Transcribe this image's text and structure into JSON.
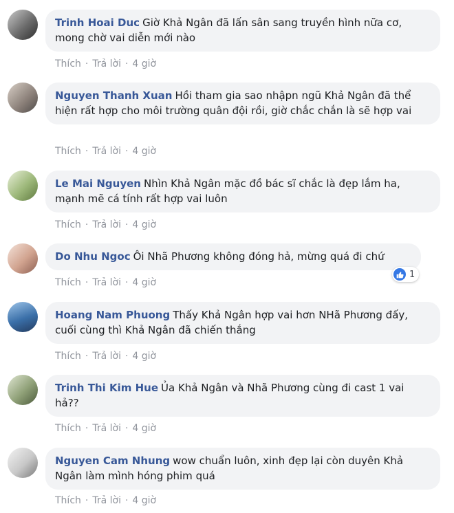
{
  "actions": {
    "like": "Thích",
    "reply": "Trả lời",
    "time": "4 giờ"
  },
  "comments": [
    {
      "author": "Trinh Hoai Duc",
      "text": "Giờ Khả Ngân đã lấn sân sang truyền hình nữa cơ, mong chờ vai diễn mới nào"
    },
    {
      "author": "Nguyen Thanh Xuan",
      "text": "Hồi tham gia sao nhậpn ngũ Khả Ngân đã thể hiện rất hợp cho môi trường quân đội rồi, giờ chắc chắn là sẽ hợp vai"
    },
    {
      "author": "Le Mai Nguyen",
      "text": "Nhìn Khả Ngân mặc đồ bác sĩ chắc là đẹp lắm ha, mạnh mẽ cá tính rất hợp vai luôn"
    },
    {
      "author": "Do Nhu Ngoc",
      "text": "Ôi Nhã Phương không đóng hả, mừng quá đi chứ",
      "reaction_count": "1"
    },
    {
      "author": "Hoang Nam Phuong",
      "text": "Thấy Khả Ngân hợp vai hơn NHã Phương đấy, cuối cùng thì Khả Ngân đã chiến thắng"
    },
    {
      "author": "Trinh Thi Kim Hue",
      "text": "Ủa Khả Ngân và Nhã Phương cùng đi cast 1 vai hả??"
    },
    {
      "author": "Nguyen Cam Nhung",
      "text": "wow chuẩn luôn, xinh đẹp lại còn duyên Khả Ngân làm mình hóng phim quá"
    }
  ],
  "colors": {
    "author": "#385898",
    "bubble": "#f2f3f5",
    "meta": "#90949c",
    "like": "#3578e5"
  }
}
